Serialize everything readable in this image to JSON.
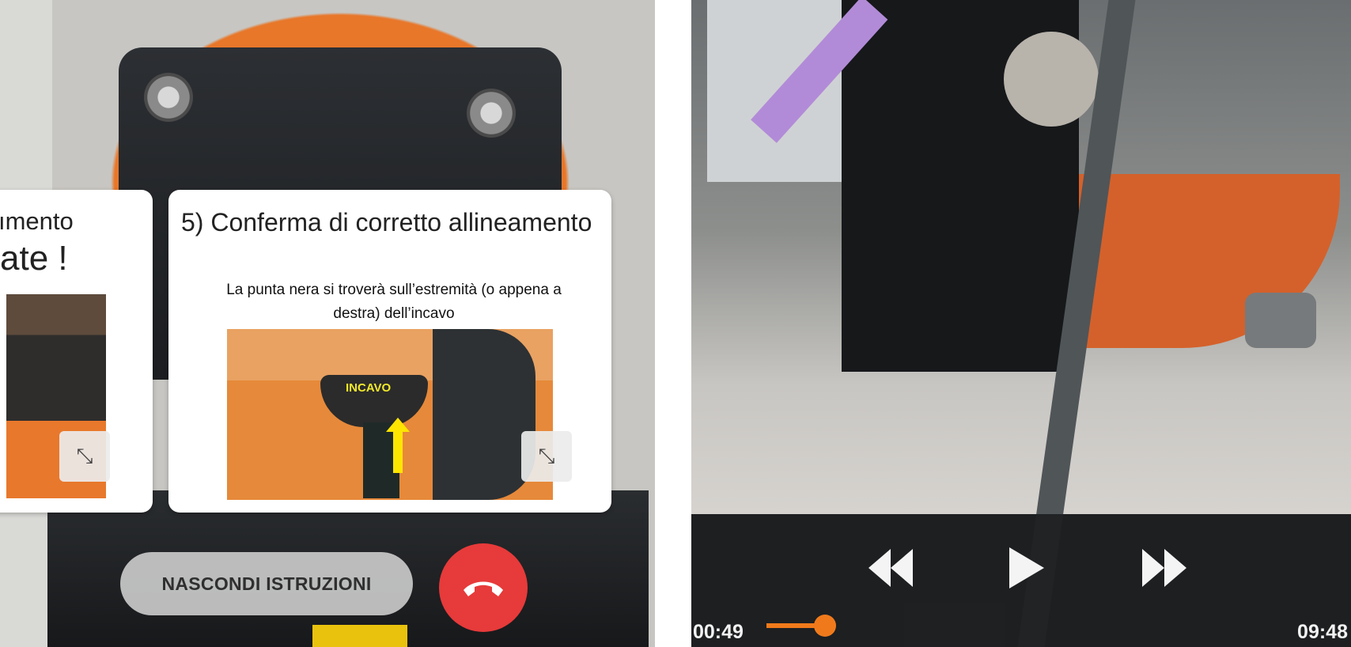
{
  "left_view": {
    "cards": [
      {
        "title_fragment": "ımento",
        "subtitle_fragment": "ate !",
        "expand_icon": "expand-arrows-icon"
      },
      {
        "title": "5) Conferma di corretto allineamento",
        "description": "La punta nera si troverà sull’estremità (o appena a destra) dell’incavo",
        "image_label": "INCAVO",
        "expand_icon": "expand-arrows-icon"
      }
    ],
    "hide_instructions_label": "NASCONDI ISTRUZIONI",
    "hangup_icon": "phone-hangup-icon",
    "colors": {
      "hangup": "#e73a3a",
      "card_bg": "#ffffff",
      "arrow": "#ffe600"
    }
  },
  "video_player": {
    "current_time": "00:49",
    "total_time": "09:48",
    "progress_fraction": 0.083,
    "controls": {
      "rewind_icon": "rewind-icon",
      "play_icon": "play-icon",
      "fast_forward_icon": "fast-forward-icon"
    },
    "colors": {
      "seek_accent": "#f07a1b",
      "annotation_arrow": "#b28bd8"
    }
  }
}
